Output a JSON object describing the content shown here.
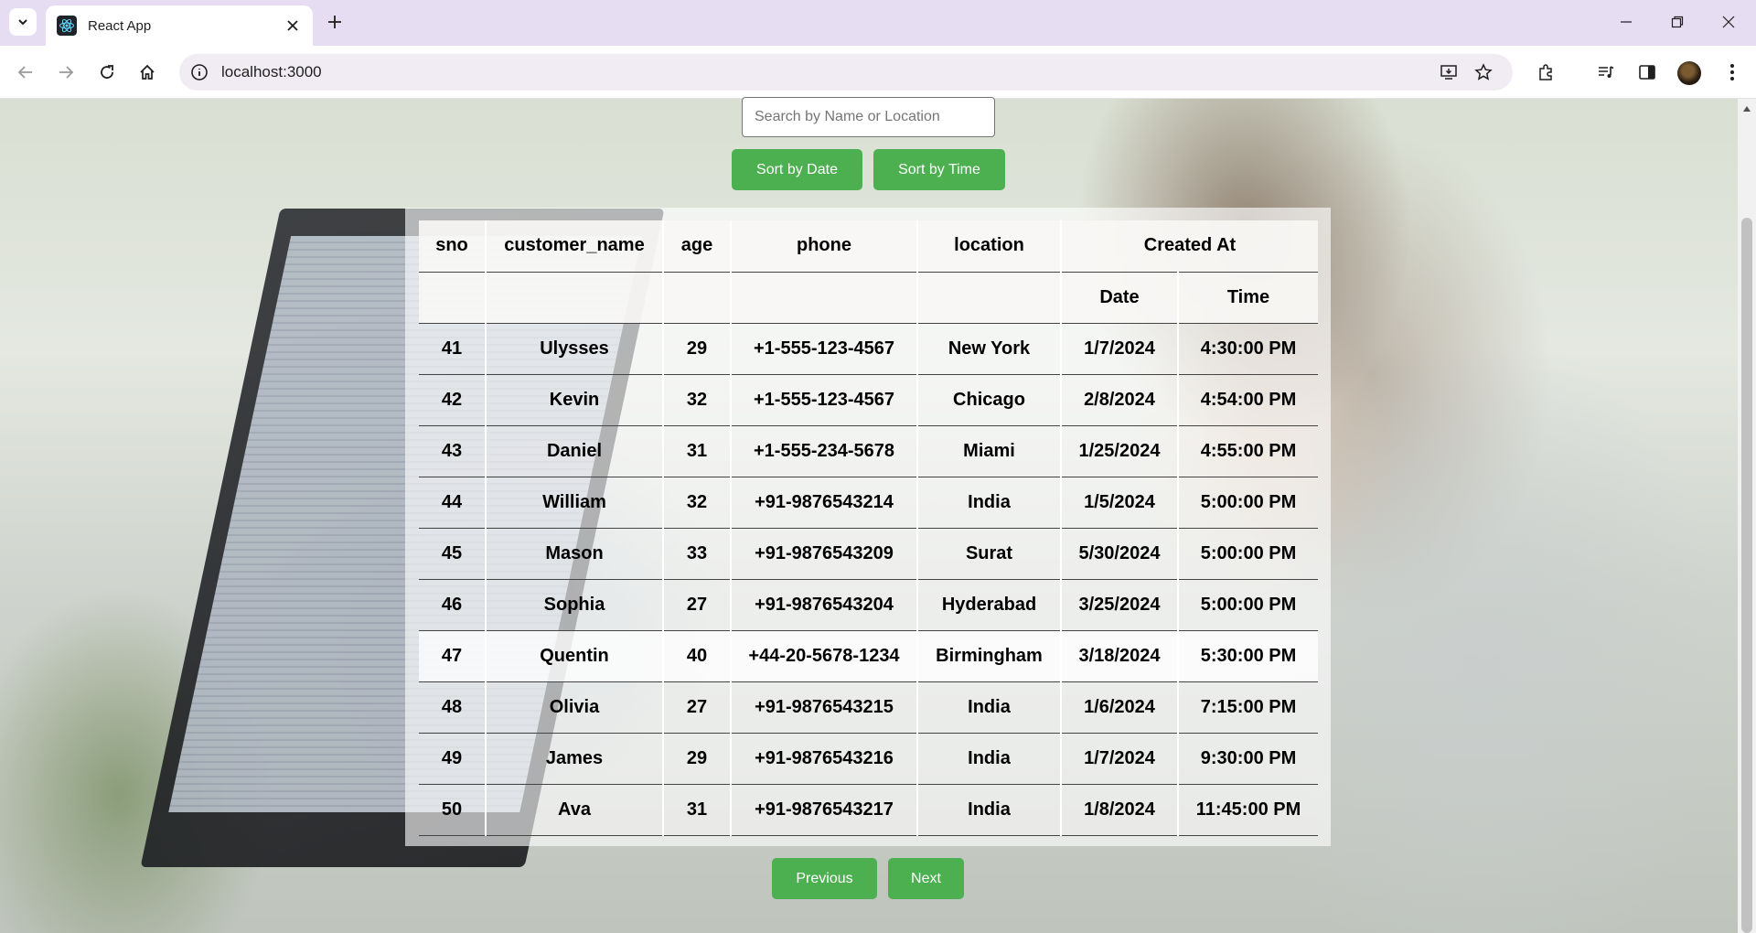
{
  "browser": {
    "tab_title": "React App",
    "url": "localhost:3000"
  },
  "search": {
    "placeholder": "Search by Name or Location",
    "value": ""
  },
  "sort_buttons": {
    "by_date": "Sort by Date",
    "by_time": "Sort by Time"
  },
  "table": {
    "headers": [
      "sno",
      "customer_name",
      "age",
      "phone",
      "location"
    ],
    "created_at_header": "Created At",
    "sub_headers": [
      "Date",
      "Time"
    ],
    "rows": [
      [
        "41",
        "Ulysses",
        "29",
        "+1-555-123-4567",
        "New York",
        "1/7/2024",
        "4:30:00 PM"
      ],
      [
        "42",
        "Kevin",
        "32",
        "+1-555-123-4567",
        "Chicago",
        "2/8/2024",
        "4:54:00 PM"
      ],
      [
        "43",
        "Daniel",
        "31",
        "+1-555-234-5678",
        "Miami",
        "1/25/2024",
        "4:55:00 PM"
      ],
      [
        "44",
        "William",
        "32",
        "+91-9876543214",
        "India",
        "1/5/2024",
        "5:00:00 PM"
      ],
      [
        "45",
        "Mason",
        "33",
        "+91-9876543209",
        "Surat",
        "5/30/2024",
        "5:00:00 PM"
      ],
      [
        "46",
        "Sophia",
        "27",
        "+91-9876543204",
        "Hyderabad",
        "3/25/2024",
        "5:00:00 PM"
      ],
      [
        "47",
        "Quentin",
        "40",
        "+44-20-5678-1234",
        "Birmingham",
        "3/18/2024",
        "5:30:00 PM"
      ],
      [
        "48",
        "Olivia",
        "27",
        "+91-9876543215",
        "India",
        "1/6/2024",
        "7:15:00 PM"
      ],
      [
        "49",
        "James",
        "29",
        "+91-9876543216",
        "India",
        "1/7/2024",
        "9:30:00 PM"
      ],
      [
        "50",
        "Ava",
        "31",
        "+91-9876543217",
        "India",
        "1/8/2024",
        "11:45:00 PM"
      ]
    ]
  },
  "pagination": {
    "previous": "Previous",
    "next": "Next"
  },
  "colors": {
    "button_green": "#4caf50",
    "tabstrip": "#e7ddf2"
  }
}
